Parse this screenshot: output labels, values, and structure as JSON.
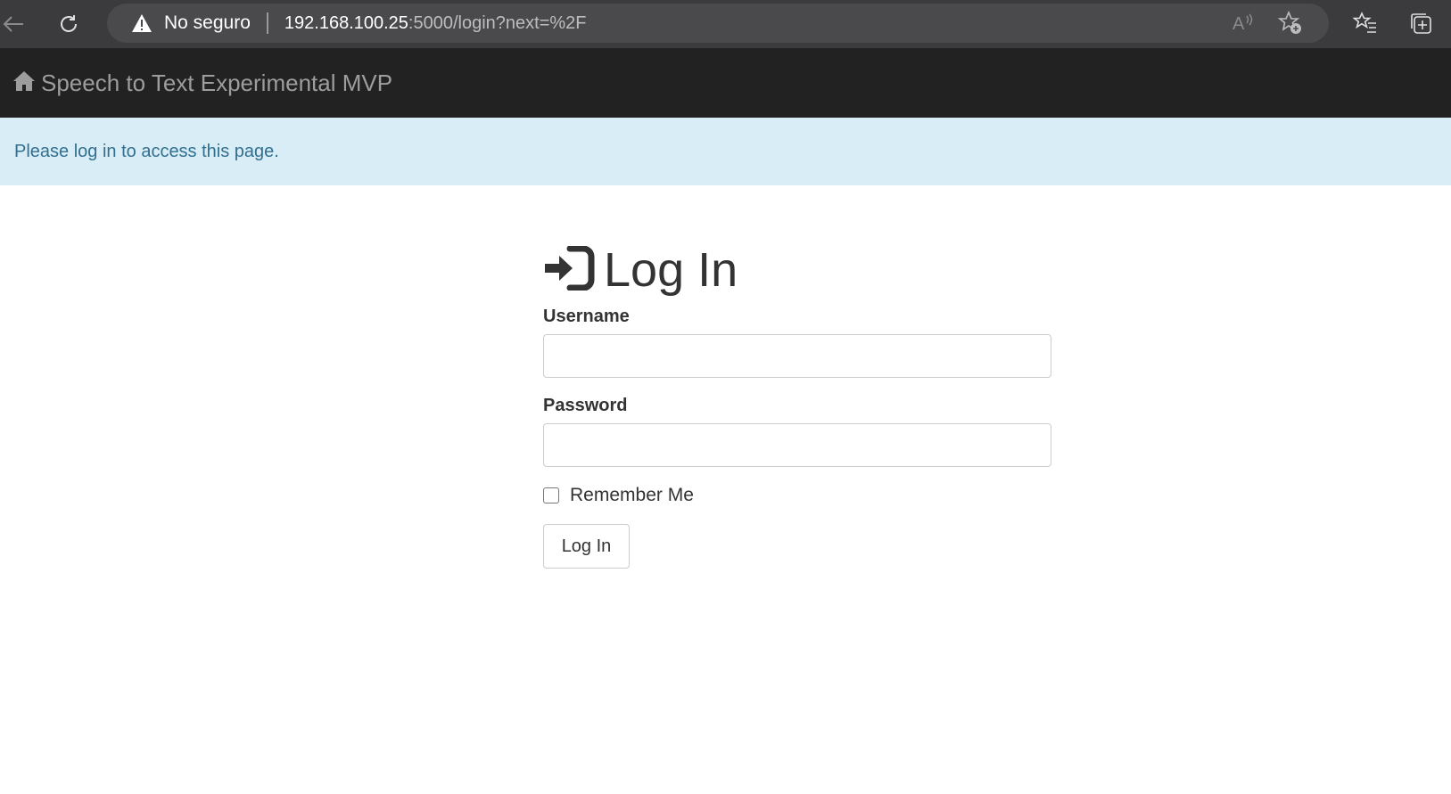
{
  "browser": {
    "security_label": "No seguro",
    "url_host": "192.168.100.25",
    "url_rest": ":5000/login?next=%2F",
    "icons": [
      "back-arrow-icon",
      "reload-icon",
      "warning-icon",
      "read-aloud-icon",
      "add-favorite-icon",
      "favorites-icon",
      "collections-icon"
    ]
  },
  "navbar": {
    "brand": "Speech to Text Experimental MVP",
    "brand_icon": "home-icon"
  },
  "alert": {
    "message": "Please log in to access this page."
  },
  "form": {
    "title": "Log In",
    "title_icon": "log-in-icon",
    "username_label": "Username",
    "username_value": "",
    "password_label": "Password",
    "password_value": "",
    "remember_label": "Remember Me",
    "remember_checked": false,
    "submit_label": "Log In"
  },
  "colors": {
    "navbar_bg": "#222222",
    "navbar_text": "#9d9d9d",
    "alert_bg": "#d9edf7",
    "alert_text": "#31708f"
  }
}
